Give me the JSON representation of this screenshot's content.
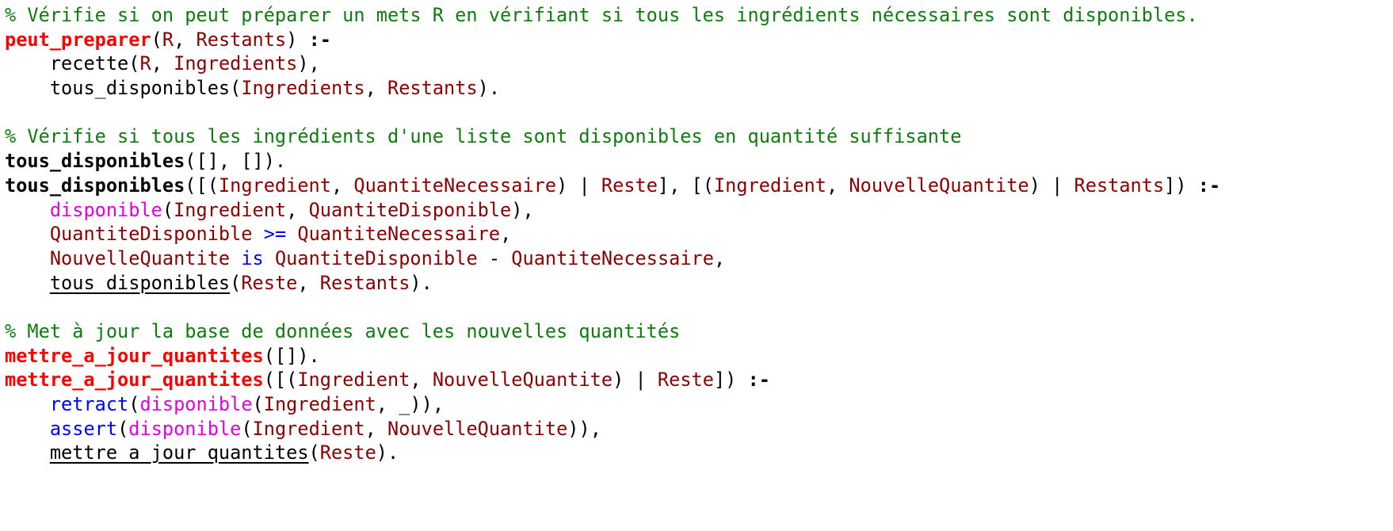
{
  "colors": {
    "comment": "#0e7c0e",
    "head_exported": "#ff0000",
    "head_local": "#000000",
    "variable": "#8b0000",
    "dynamic_predicate": "#e000e0",
    "builtin": "#0000ff",
    "default": "#000000"
  },
  "lines": [
    [
      {
        "t": "comment",
        "v": "% Vérifie si on peut préparer un mets R en vérifiant si tous les ingrédients nécessaires sont disponibles."
      }
    ],
    [
      {
        "t": "head-red",
        "v": "peut_preparer"
      },
      {
        "t": "punct",
        "v": "("
      },
      {
        "t": "var",
        "v": "R"
      },
      {
        "t": "punct",
        "v": ", "
      },
      {
        "t": "var",
        "v": "Restants"
      },
      {
        "t": "punct",
        "v": ") "
      },
      {
        "t": "neck",
        "v": ":-"
      }
    ],
    [
      {
        "t": "punct",
        "v": "    "
      },
      {
        "t": "call",
        "v": "recette"
      },
      {
        "t": "punct",
        "v": "("
      },
      {
        "t": "var",
        "v": "R"
      },
      {
        "t": "punct",
        "v": ", "
      },
      {
        "t": "var",
        "v": "Ingredients"
      },
      {
        "t": "punct",
        "v": "),"
      }
    ],
    [
      {
        "t": "punct",
        "v": "    "
      },
      {
        "t": "call",
        "v": "tous_disponibles"
      },
      {
        "t": "punct",
        "v": "("
      },
      {
        "t": "var",
        "v": "Ingredients"
      },
      {
        "t": "punct",
        "v": ", "
      },
      {
        "t": "var",
        "v": "Restants"
      },
      {
        "t": "punct",
        "v": ")."
      }
    ],
    [],
    [
      {
        "t": "comment",
        "v": "% Vérifie si tous les ingrédients d'une liste sont disponibles en quantité suffisante"
      }
    ],
    [
      {
        "t": "head-black",
        "v": "tous_disponibles"
      },
      {
        "t": "punct",
        "v": "([], [])."
      }
    ],
    [
      {
        "t": "head-black",
        "v": "tous_disponibles"
      },
      {
        "t": "punct",
        "v": "([("
      },
      {
        "t": "var",
        "v": "Ingredient"
      },
      {
        "t": "punct",
        "v": ", "
      },
      {
        "t": "var",
        "v": "QuantiteNecessaire"
      },
      {
        "t": "punct",
        "v": ") | "
      },
      {
        "t": "var",
        "v": "Reste"
      },
      {
        "t": "punct",
        "v": "], [("
      },
      {
        "t": "var",
        "v": "Ingredient"
      },
      {
        "t": "punct",
        "v": ", "
      },
      {
        "t": "var",
        "v": "NouvelleQuantite"
      },
      {
        "t": "punct",
        "v": ") | "
      },
      {
        "t": "var",
        "v": "Restants"
      },
      {
        "t": "punct",
        "v": "]) "
      },
      {
        "t": "neck",
        "v": ":-"
      }
    ],
    [
      {
        "t": "punct",
        "v": "    "
      },
      {
        "t": "dyn",
        "v": "disponible"
      },
      {
        "t": "punct",
        "v": "("
      },
      {
        "t": "var",
        "v": "Ingredient"
      },
      {
        "t": "punct",
        "v": ", "
      },
      {
        "t": "var",
        "v": "QuantiteDisponible"
      },
      {
        "t": "punct",
        "v": "),"
      }
    ],
    [
      {
        "t": "punct",
        "v": "    "
      },
      {
        "t": "var",
        "v": "QuantiteDisponible"
      },
      {
        "t": "punct",
        "v": " "
      },
      {
        "t": "builtin",
        "v": ">="
      },
      {
        "t": "punct",
        "v": " "
      },
      {
        "t": "var",
        "v": "QuantiteNecessaire"
      },
      {
        "t": "punct",
        "v": ","
      }
    ],
    [
      {
        "t": "punct",
        "v": "    "
      },
      {
        "t": "var",
        "v": "NouvelleQuantite"
      },
      {
        "t": "punct",
        "v": " "
      },
      {
        "t": "builtin",
        "v": "is"
      },
      {
        "t": "punct",
        "v": " "
      },
      {
        "t": "var",
        "v": "QuantiteDisponible"
      },
      {
        "t": "punct",
        "v": " - "
      },
      {
        "t": "var",
        "v": "QuantiteNecessaire"
      },
      {
        "t": "punct",
        "v": ","
      }
    ],
    [
      {
        "t": "punct",
        "v": "    "
      },
      {
        "t": "recursive",
        "v": "tous_disponibles"
      },
      {
        "t": "punct",
        "v": "("
      },
      {
        "t": "var",
        "v": "Reste"
      },
      {
        "t": "punct",
        "v": ", "
      },
      {
        "t": "var",
        "v": "Restants"
      },
      {
        "t": "punct",
        "v": ")."
      }
    ],
    [],
    [
      {
        "t": "comment",
        "v": "% Met à jour la base de données avec les nouvelles quantités"
      }
    ],
    [
      {
        "t": "head-red",
        "v": "mettre_a_jour_quantites"
      },
      {
        "t": "punct",
        "v": "([])."
      }
    ],
    [
      {
        "t": "head-red",
        "v": "mettre_a_jour_quantites"
      },
      {
        "t": "punct",
        "v": "([("
      },
      {
        "t": "var",
        "v": "Ingredient"
      },
      {
        "t": "punct",
        "v": ", "
      },
      {
        "t": "var",
        "v": "NouvelleQuantite"
      },
      {
        "t": "punct",
        "v": ") | "
      },
      {
        "t": "var",
        "v": "Reste"
      },
      {
        "t": "punct",
        "v": "]) "
      },
      {
        "t": "neck",
        "v": ":-"
      }
    ],
    [
      {
        "t": "punct",
        "v": "    "
      },
      {
        "t": "builtin",
        "v": "retract"
      },
      {
        "t": "punct",
        "v": "("
      },
      {
        "t": "dyn",
        "v": "disponible"
      },
      {
        "t": "punct",
        "v": "("
      },
      {
        "t": "var",
        "v": "Ingredient"
      },
      {
        "t": "punct",
        "v": ", _)),"
      }
    ],
    [
      {
        "t": "punct",
        "v": "    "
      },
      {
        "t": "builtin",
        "v": "assert"
      },
      {
        "t": "punct",
        "v": "("
      },
      {
        "t": "dyn",
        "v": "disponible"
      },
      {
        "t": "punct",
        "v": "("
      },
      {
        "t": "var",
        "v": "Ingredient"
      },
      {
        "t": "punct",
        "v": ", "
      },
      {
        "t": "var",
        "v": "NouvelleQuantite"
      },
      {
        "t": "punct",
        "v": ")),"
      }
    ],
    [
      {
        "t": "punct",
        "v": "    "
      },
      {
        "t": "recursive",
        "v": "mettre_a_jour_quantites"
      },
      {
        "t": "punct",
        "v": "("
      },
      {
        "t": "var",
        "v": "Reste"
      },
      {
        "t": "punct",
        "v": ")."
      }
    ]
  ]
}
